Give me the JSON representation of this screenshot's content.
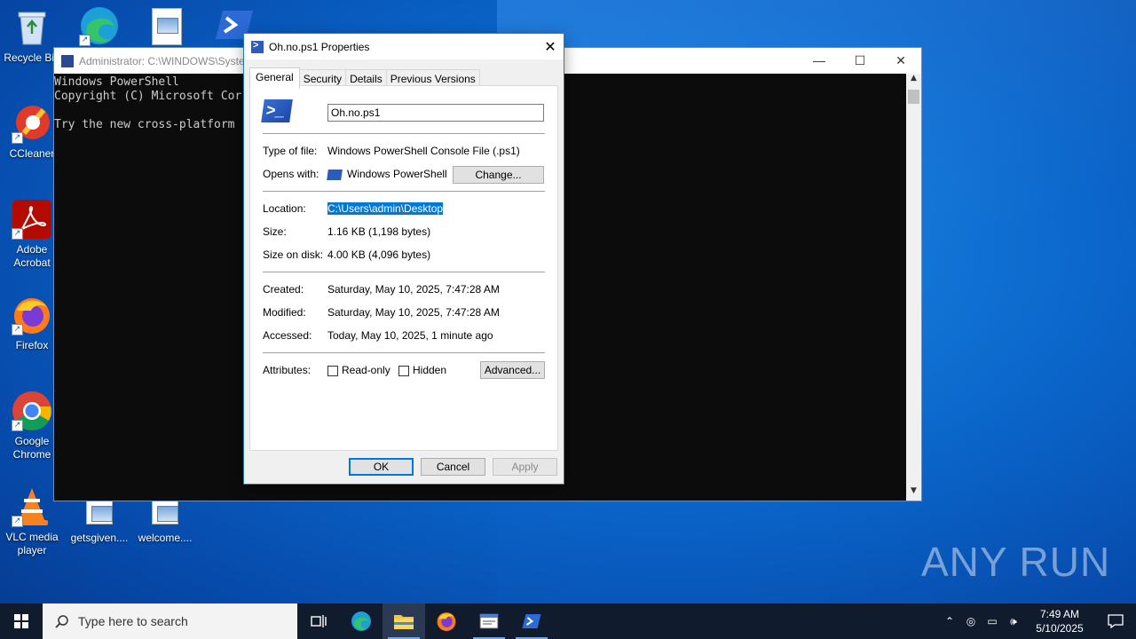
{
  "desktop": {
    "icons": [
      {
        "label": "Recycle Bin",
        "icon": "recycle-bin-icon"
      },
      {
        "label": "CCleaner",
        "icon": "ccleaner-icon"
      },
      {
        "label": "Adobe Acrobat",
        "icon": "acrobat-icon"
      },
      {
        "label": "Firefox",
        "icon": "firefox-icon"
      },
      {
        "label": "Google Chrome",
        "icon": "chrome-icon"
      },
      {
        "label": "VLC media player",
        "icon": "vlc-icon"
      },
      {
        "label": "getsgiven....",
        "icon": "image-file-icon"
      },
      {
        "label": "welcome....",
        "icon": "image-file-icon"
      }
    ]
  },
  "powershell_window": {
    "title": "Administrator: C:\\WINDOWS\\Syste",
    "lines": [
      "Windows PowerShell",
      "Copyright (C) Microsoft Cor",
      "",
      "Try the new cross-platform"
    ]
  },
  "dialog": {
    "title": "Oh.no.ps1 Properties",
    "tabs": [
      "General",
      "Security",
      "Details",
      "Previous Versions"
    ],
    "file_name": "Oh.no.ps1",
    "type_label": "Type of file:",
    "type_value": "Windows PowerShell Console File (.ps1)",
    "opens_label": "Opens with:",
    "opens_value": "Windows PowerShell",
    "change_button": "Change...",
    "location_label": "Location:",
    "location_value": "C:\\Users\\admin\\Desktop",
    "size_label": "Size:",
    "size_value": "1.16 KB (1,198 bytes)",
    "size_disk_label": "Size on disk:",
    "size_disk_value": "4.00 KB (4,096 bytes)",
    "created_label": "Created:",
    "created_value": "Saturday, May 10, 2025, 7:47:28 AM",
    "modified_label": "Modified:",
    "modified_value": "Saturday, May 10, 2025, 7:47:28 AM",
    "accessed_label": "Accessed:",
    "accessed_value": "Today, May 10, 2025, 1 minute ago",
    "attributes_label": "Attributes:",
    "readonly_label": "Read-only",
    "hidden_label": "Hidden",
    "advanced_button": "Advanced...",
    "ok_button": "OK",
    "cancel_button": "Cancel",
    "apply_button": "Apply"
  },
  "watermark": "ANY RUN",
  "taskbar": {
    "search_placeholder": "Type here to search",
    "time": "7:49 AM",
    "date": "5/10/2025"
  }
}
